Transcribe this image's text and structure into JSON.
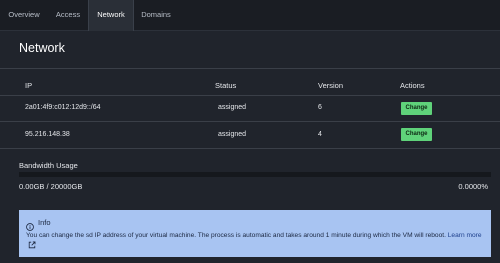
{
  "tabs": [
    {
      "label": "Overview"
    },
    {
      "label": "Access"
    },
    {
      "label": "Network",
      "active": true
    },
    {
      "label": "Domains"
    }
  ],
  "page": {
    "title": "Network"
  },
  "table": {
    "headers": {
      "ip": "IP",
      "status": "Status",
      "version": "Version",
      "actions": "Actions"
    },
    "rows": [
      {
        "ip": "2a01:4f9:c012:12d9::/64",
        "status": "assigned",
        "version": "6",
        "action": "Change"
      },
      {
        "ip": "95.216.148.38",
        "status": "assigned",
        "version": "4",
        "action": "Change"
      }
    ]
  },
  "bandwidth": {
    "title": "Bandwidth Usage",
    "value": "0.00GB / 20000GB",
    "percent": "0.0000%",
    "fraction": 0.0
  },
  "info": {
    "icon": "info-circle-icon",
    "title": "Info",
    "text": "You can change the sd IP address of your virtual machine. The process is automatic and takes around 1 minute during which the VM will reboot.",
    "link": "Learn more",
    "link_icon": "external-link-icon"
  },
  "colors": {
    "accent": "#5fd27a",
    "info_bg": "#a8c4f2",
    "background": "#20242c"
  }
}
